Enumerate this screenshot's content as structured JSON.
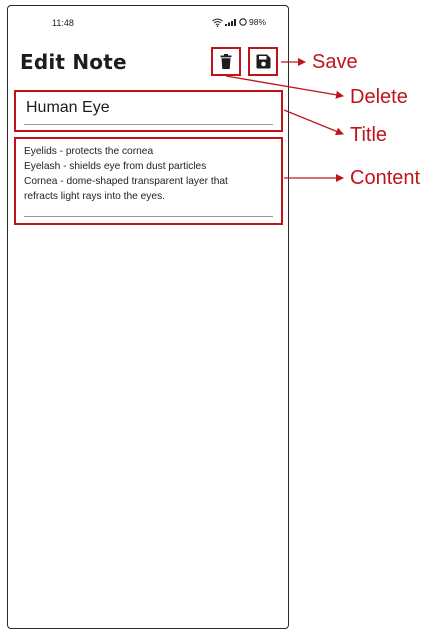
{
  "status_bar": {
    "time": "11:48",
    "battery": "98%"
  },
  "header": {
    "title": "Edit Note",
    "delete_icon": "trash-icon",
    "save_icon": "floppy-disk-icon"
  },
  "note": {
    "title": "Human Eye",
    "content_lines": [
      "Eyelids - protects the cornea",
      "Eyelash - shields eye from dust particles",
      "Cornea - dome-shaped transparent layer that",
      "refracts light rays into the eyes."
    ]
  },
  "annotations": {
    "save": "Save",
    "delete": "Delete",
    "title": "Title",
    "content": "Content",
    "color": "#c0141c"
  }
}
